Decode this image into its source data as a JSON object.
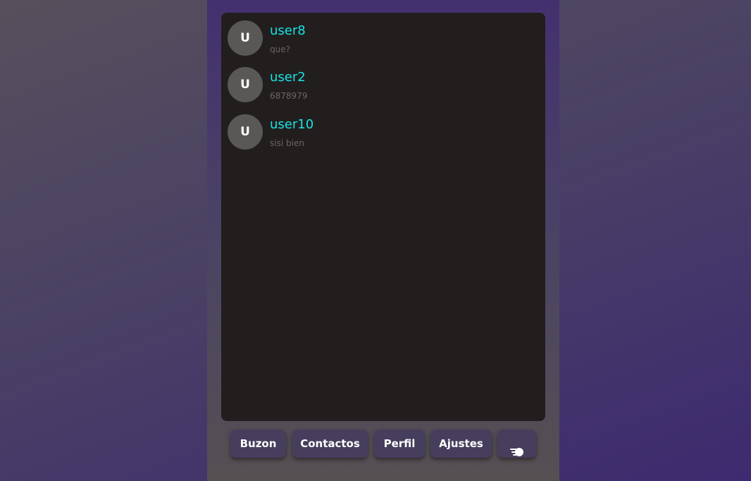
{
  "chats": [
    {
      "avatar_initial": "U",
      "name": "user8",
      "preview": "que?"
    },
    {
      "avatar_initial": "U",
      "name": "user2",
      "preview": "6878979"
    },
    {
      "avatar_initial": "U",
      "name": "user10",
      "preview": "sisi bien"
    }
  ],
  "nav": {
    "buzon_label": "Buzon",
    "contactos_label": "Contactos",
    "perfil_label": "Perfil",
    "ajustes_label": "Ajustes",
    "exit_icon": "logout-hand-icon"
  },
  "colors": {
    "name": "#18e4e4",
    "panel": "#221e1e",
    "button": "#463e5c",
    "avatar": "#5a5856"
  }
}
